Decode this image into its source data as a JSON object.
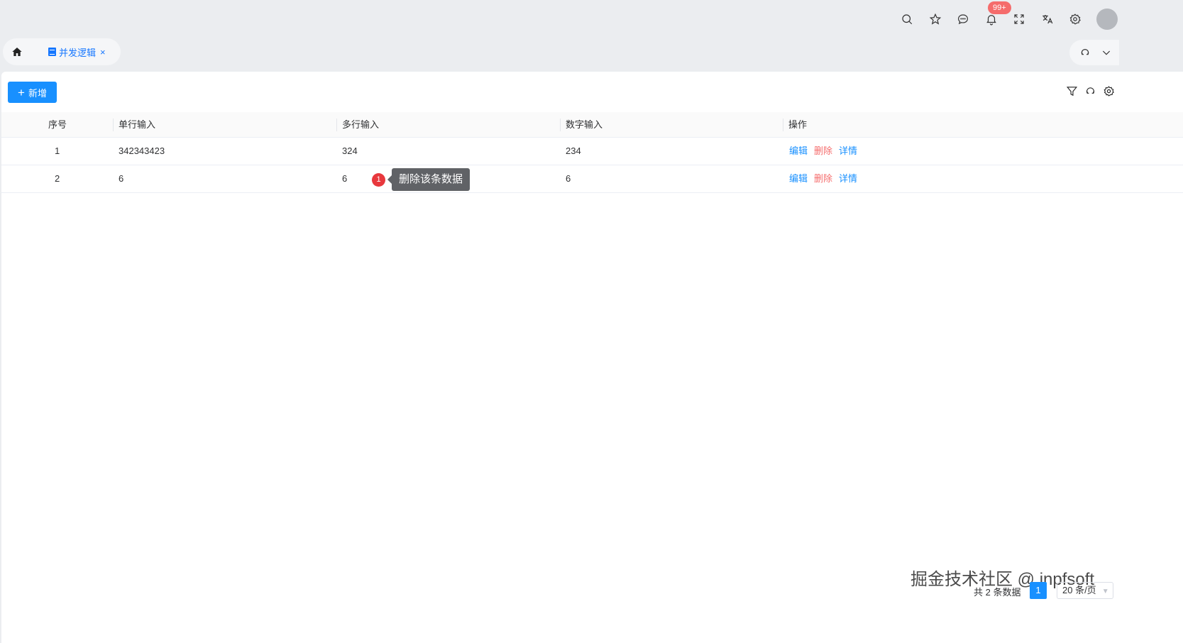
{
  "header": {
    "notification_badge": "99+",
    "icons": [
      "search-icon",
      "star-icon",
      "message-icon",
      "bell-icon",
      "fullscreen-icon",
      "translate-icon",
      "gear-icon",
      "avatar"
    ]
  },
  "tabs": {
    "active_label": "并发逻辑",
    "close_glyph": "×"
  },
  "toolbar": {
    "add_label": "新增"
  },
  "table": {
    "columns": [
      "序号",
      "单行输入",
      "多行输入",
      "数字输入",
      "操作"
    ],
    "rows": [
      {
        "index": "1",
        "single": "342343423",
        "multi": "324",
        "number": "234"
      },
      {
        "index": "2",
        "single": "6",
        "multi": "6",
        "number": "6"
      }
    ],
    "actions": {
      "edit": "编辑",
      "delete": "删除",
      "detail": "详情"
    }
  },
  "annotation": {
    "marker": "1",
    "tooltip": "删除该条数据"
  },
  "pagination": {
    "total_text": "共 2 条数据",
    "current_page": "1",
    "page_size": "20 条/页"
  },
  "watermark": "掘金技术社区 @ jnpfsoft",
  "colors": {
    "primary": "#1890ff",
    "danger": "#f56c6c",
    "badge": "#f56c6c",
    "marker": "#e8383d"
  }
}
